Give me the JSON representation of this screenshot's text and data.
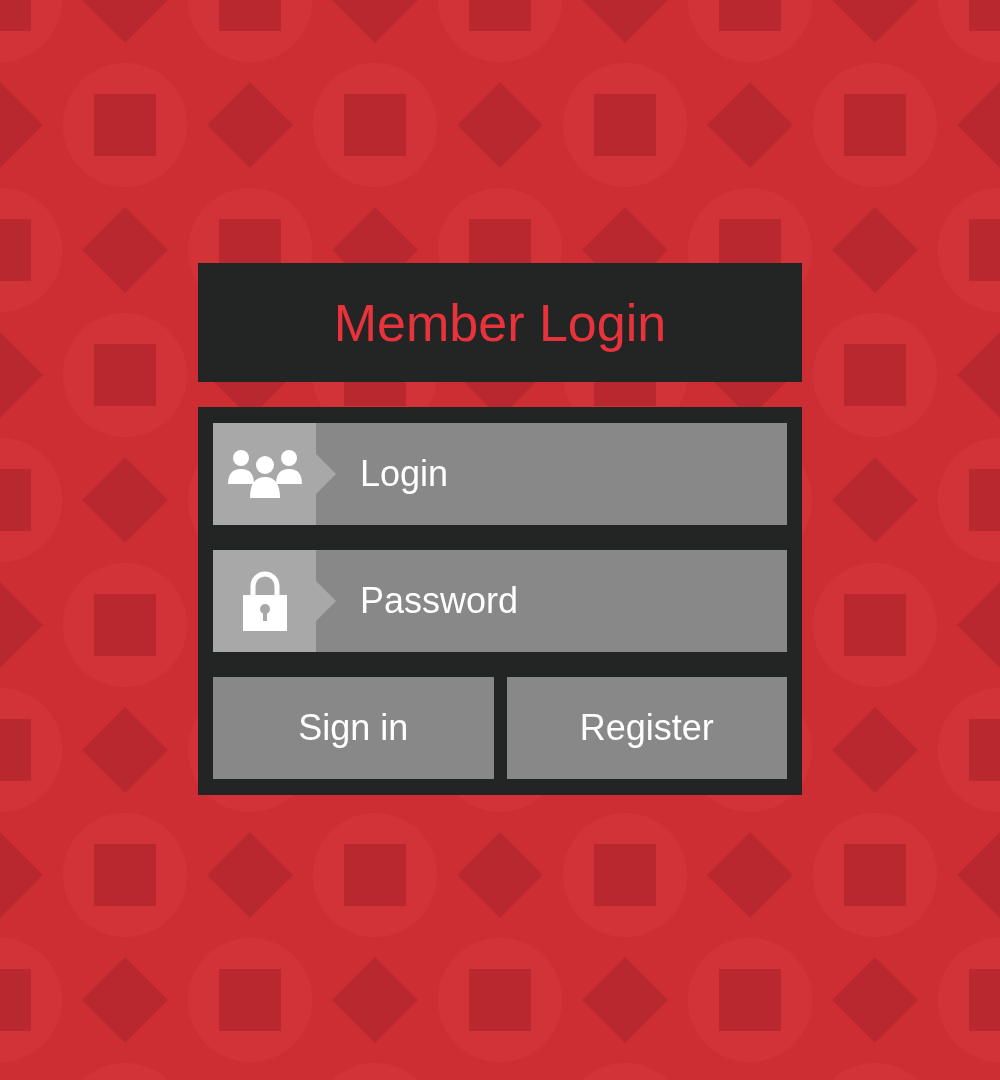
{
  "title": "Member Login",
  "fields": [
    {
      "kind": "user",
      "placeholder": "Login"
    },
    {
      "kind": "lock",
      "placeholder": "Password"
    }
  ],
  "buttons": [
    "Sign in",
    "Register"
  ]
}
